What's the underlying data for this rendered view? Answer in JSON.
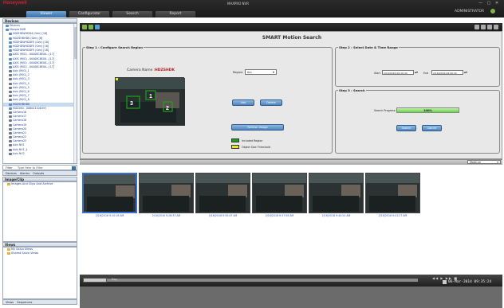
{
  "app": {
    "brand": "Honeywell",
    "title": "MAXPRO NVR",
    "user": "ADMINISTRATOR"
  },
  "tabs": [
    {
      "label": "Viewer"
    },
    {
      "label": "Configurator"
    },
    {
      "label": "Search"
    },
    {
      "label": "Report"
    }
  ],
  "devices": {
    "title": "Devices",
    "items": [
      {
        "label": "Devices"
      },
      {
        "label": "Maxpro NVR"
      },
      {
        "label": "HDZHDWHDD4 (Gen) [16]"
      },
      {
        "label": "HDZSHBHDK (Gen) [6]"
      },
      {
        "label": "HDZHDWHDDFE (Gen) [16]"
      },
      {
        "label": "HDZHDWHDDFE (Gen) [16]"
      },
      {
        "label": "HDZHDWHDDFE (Gen) [16]"
      },
      {
        "label": "AXIS (M/G) - 00408C6E00...[17]"
      },
      {
        "label": "AXIS (M/G) - 00408C6E00...[17]"
      },
      {
        "label": "AXIS (M/G) - 00408C6E00...[17]"
      },
      {
        "label": "AXIS (M/G) - 00408C6E00...[17]"
      },
      {
        "label": "Axis (M/G)_1"
      },
      {
        "label": "Axis (M/G)_2"
      },
      {
        "label": "Axis (M/G)_3"
      },
      {
        "label": "Axis (M/G)_4"
      },
      {
        "label": "Axis (M/G)_5"
      },
      {
        "label": "Axis (M/G)_6"
      },
      {
        "label": "Axis (M/G)_7"
      },
      {
        "label": "Axis (M/G)_8"
      },
      {
        "label": "HDZSHBHDK"
      },
      {
        "label": "HDZ280 - 00804110D.EH"
      },
      {
        "label": "Camera16"
      },
      {
        "label": "Camera17"
      },
      {
        "label": "Camera18"
      },
      {
        "label": "Camera19"
      },
      {
        "label": "Camera20"
      },
      {
        "label": "Camera21"
      },
      {
        "label": "Camera22"
      },
      {
        "label": "Camera23"
      },
      {
        "label": "Axis NV1"
      },
      {
        "label": "Axis NV1_1"
      },
      {
        "label": "Axis NV2"
      }
    ]
  },
  "filter": {
    "label": "Filter",
    "placeholder": "Type Here to Filter"
  },
  "left_tabs": [
    {
      "label": "Devices"
    },
    {
      "label": "Alarms"
    },
    {
      "label": "Outputs"
    }
  ],
  "imageclip": {
    "title": "Image/Clip",
    "empty": "Images And Clips And Archive"
  },
  "views": {
    "title": "Views",
    "items": [
      {
        "label": "My Salvo Views"
      },
      {
        "label": "Shared Salvo Views"
      }
    ]
  },
  "bottom_tabs": [
    {
      "label": "Views"
    },
    {
      "label": "Sequences"
    }
  ],
  "search": {
    "title": "SMART Motion Search",
    "step1": "Step 1 : Configure Search Region",
    "camera_label": "Camera Name :",
    "camera_name": "HDZSHDK",
    "region_label": "Region:",
    "region_value": "ALL",
    "add_label": "Add",
    "delete_label": "Delete",
    "refresh_label": "Refresh Image",
    "legend_included": "Included Region",
    "legend_threshold": "Object Size Threshold",
    "regions": [
      "1",
      "2",
      "3"
    ],
    "step2": "Step 2 : Select Date & Time Range",
    "start_label": "Start",
    "start_value": "2/16/2016 09:10:32",
    "end_label": "End",
    "end_value": "2/16/2016 09:40:32",
    "step3": "Step 3 : Search",
    "progress_label": "Search Progress:",
    "progress_text": "100%",
    "progress_value": 100,
    "search_label": "Search",
    "cancel_label": "Cancel"
  },
  "size_option": "Medium",
  "thumbnails": [
    {
      "caption": "2/16/2016 9:10:16 AM"
    },
    {
      "caption": "2/16/2016 9:26:37 AM"
    },
    {
      "caption": "2/16/2016 9:30:47 AM"
    },
    {
      "caption": "2/16/2016 9:37:58 AM"
    },
    {
      "caption": "2/16/2016 9:40:20 AM"
    },
    {
      "caption": "2/16/2016 9:41:27 AM"
    }
  ],
  "player": {
    "time": "06-Mar-2014 09:35:24",
    "mode": "Day"
  },
  "colors": {
    "included": "#1aa31a",
    "threshold": "#e8e820",
    "selection": "#3b6fd0"
  }
}
